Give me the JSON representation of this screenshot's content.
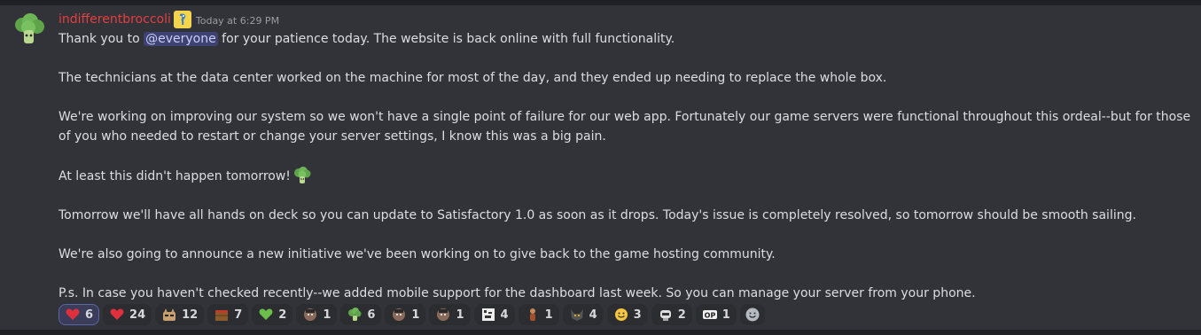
{
  "message": {
    "author": "indifferentbroccoli",
    "role_badge_icon": "seahorse-role-icon",
    "timestamp": "Today at 6:29 PM",
    "line1_before": "Thank you to ",
    "mention": "@everyone",
    "line1_after": " for your patience today. The website is back online with full functionality.",
    "p2": "The technicians at the data center worked on the machine for most of the day, and they ended up needing to replace the whole box.",
    "p3": "We're working on improving our system so we won't have a single point of failure for our web app. Fortunately our game servers were functional throughout this ordeal--but for those of you who needed to restart or change your server settings, I know this was a big pain.",
    "p4": "At least this didn't happen tomorrow!",
    "p4_emoji": "broccoli-emoji",
    "p5": "Tomorrow we'll have all hands on deck so you can update to Satisfactory 1.0 as soon as it drops. Today's issue is completely resolved, so tomorrow should be smooth sailing.",
    "p6": "We're also going to announce a new initiative we've been working on to give back to the game hosting community.",
    "p7": "P.s. In case you haven't checked recently--we added mobile support for the dashboard last week. So you can manage your server from your phone."
  },
  "reactions": [
    {
      "emoji": "heart-emoji",
      "count": "6",
      "me": true
    },
    {
      "emoji": "heart-emoji",
      "count": "24",
      "me": false
    },
    {
      "emoji": "cat-emoji",
      "count": "12",
      "me": false
    },
    {
      "emoji": "crate-emoji",
      "count": "7",
      "me": false
    },
    {
      "emoji": "green-heart-emoji",
      "count": "2",
      "me": false
    },
    {
      "emoji": "face-emoji",
      "count": "1",
      "me": false
    },
    {
      "emoji": "broccoli-emoji",
      "count": "6",
      "me": false
    },
    {
      "emoji": "face-emoji",
      "count": "1",
      "me": false
    },
    {
      "emoji": "face-emoji",
      "count": "1",
      "me": false
    },
    {
      "emoji": "pixel-art-emoji",
      "count": "4",
      "me": false
    },
    {
      "emoji": "figure-emoji",
      "count": "1",
      "me": false
    },
    {
      "emoji": "wolf-emoji",
      "count": "4",
      "me": false
    },
    {
      "emoji": "smile-emoji",
      "count": "3",
      "me": false
    },
    {
      "emoji": "robot-emoji",
      "count": "2",
      "me": false
    },
    {
      "emoji": "op-emoji",
      "count": "1",
      "me": false
    }
  ],
  "colors": {
    "background": "#323339",
    "username": "#e23f3f",
    "mention_bg": "#3e4270",
    "text": "#dbdee1"
  }
}
